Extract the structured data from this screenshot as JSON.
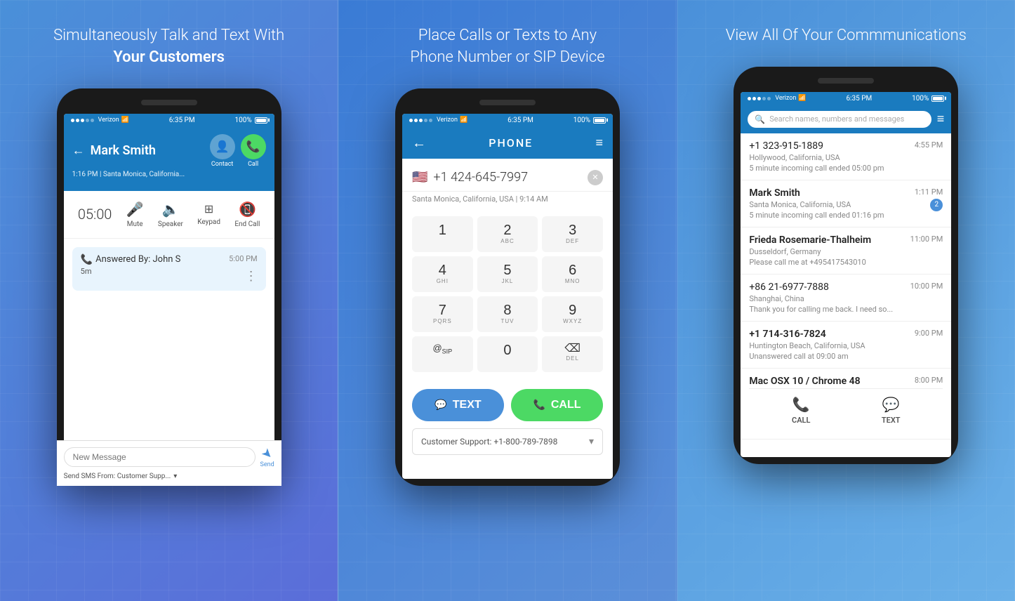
{
  "panels": {
    "left": {
      "title_line1": "Simultaneously Talk and Text With",
      "title_line2": "Your Customers",
      "phone": {
        "status": {
          "carrier": "●●●○○ Verizon",
          "wifi": "WiFi",
          "time": "6:35 PM",
          "battery": "100%"
        },
        "contact_name": "Mark Smith",
        "contact_meta": "1:16 PM | Santa Monica, California...",
        "back_label": "←",
        "action_contact": "Contact",
        "action_call": "Call",
        "call_timer": "05:00",
        "controls": [
          {
            "label": "Mute",
            "icon": "🎤"
          },
          {
            "label": "Speaker",
            "icon": "🔈"
          },
          {
            "label": "Keypad",
            "icon": "⊞"
          },
          {
            "label": "End Call",
            "icon": "📵"
          }
        ],
        "answered_by": "Answered By: John S",
        "answered_duration": "5m",
        "answered_time": "5:00 PM",
        "message_placeholder": "New Message",
        "send_label": "Send",
        "sms_from": "Send SMS From: Customer Supp..."
      }
    },
    "middle": {
      "title": "Place Calls or Texts to Any Phone Number or SIP Device",
      "phone": {
        "status": {
          "carrier": "●●●○○ Verizon",
          "wifi": "WiFi",
          "time": "6:35 PM",
          "battery": "100%"
        },
        "header_title": "PHONE",
        "flag": "🇺🇸",
        "phone_number": "+1 424-645-7997",
        "subtitle": "Santa Monica, California, USA | 9:14 AM",
        "keys": [
          [
            {
              "main": "1",
              "sub": ""
            },
            {
              "main": "2",
              "sub": "ABC"
            },
            {
              "main": "3",
              "sub": "DEF"
            }
          ],
          [
            {
              "main": "4",
              "sub": "GHI"
            },
            {
              "main": "5",
              "sub": "JKL"
            },
            {
              "main": "6",
              "sub": "MNO"
            }
          ],
          [
            {
              "main": "7",
              "sub": "PQRS"
            },
            {
              "main": "8",
              "sub": "TUV"
            },
            {
              "main": "9",
              "sub": "WXYZ"
            }
          ],
          [
            {
              "main": "@SIP",
              "sub": ""
            },
            {
              "main": "0",
              "sub": ""
            },
            {
              "main": "⌫",
              "sub": "DEL"
            }
          ]
        ],
        "text_btn": "TEXT",
        "call_btn": "CALL",
        "customer_support": "Customer Support: +1-800-789-7898"
      }
    },
    "right": {
      "title": "View All Of Your Commmunications",
      "phone": {
        "status": {
          "carrier": "●●●○○ Verizon",
          "wifi": "WiFi",
          "time": "6:35 PM",
          "battery": "100%"
        },
        "search_placeholder": "Search names, numbers and messages",
        "items": [
          {
            "name": "+1 323-915-1889",
            "bold": false,
            "time": "4:55 PM",
            "location": "Hollywood, California, USA",
            "message": "5 minute incoming call ended 05:00 pm",
            "unread": null
          },
          {
            "name": "Mark Smith",
            "bold": true,
            "time": "1:11 PM",
            "location": "Santa Monica, California, USA",
            "message": "5 minute incoming call ended 01:16 pm",
            "unread": "2"
          },
          {
            "name": "Frieda Rosemarie-Thalheim",
            "bold": true,
            "time": "11:00 PM",
            "location": "Dusseldorf, Germany",
            "message": "Please call me at +495417543010",
            "unread": null
          },
          {
            "name": "+86 21-6977-7888",
            "bold": false,
            "time": "10:00 PM",
            "location": "Shanghai, China",
            "message": "Thank you for calling me back. I need so...",
            "unread": null
          },
          {
            "name": "+1 714-316-7824",
            "bold": true,
            "time": "9:00 PM",
            "location": "Huntington Beach, California, USA",
            "message": "Unanswered call at 09:00 am",
            "unread": null
          },
          {
            "name": "Mac OSX 10 / Chrome 48",
            "bold": true,
            "time": "8:00 PM",
            "location": "",
            "message": "",
            "unread": null,
            "bottom_actions": true
          }
        ],
        "bottom_call": "CALL",
        "bottom_text": "TEXT"
      }
    }
  }
}
